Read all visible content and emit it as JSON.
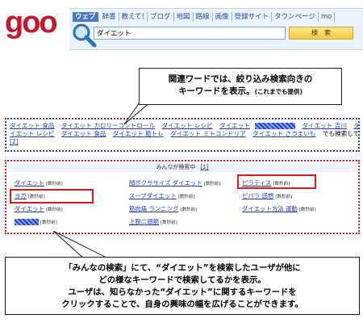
{
  "header": {
    "logo": "goo",
    "tabs": [
      "ウェブ",
      "辞書",
      "教えて!",
      "ブログ",
      "地図",
      "路線",
      "画像",
      "登録サイト",
      "タウンページ",
      "mo"
    ],
    "search_value": "ダイエット",
    "search_button": "検　索"
  },
  "callout_top": {
    "line1": "関連ワードでは、絞り込み検索向きの",
    "line2": "キーワードを表示。",
    "line2_small": "(これまでも提供)"
  },
  "related": {
    "row1": [
      "ダイエット 食品",
      "ダイエット カロリーコントロール",
      "ダイエット レシピ",
      "ダイエット",
      "ダイエット 吉川",
      "ダ"
    ],
    "row2": [
      "イエット レシピ",
      "ダイエット 食品",
      "ダイエット 筋トレ",
      "ダイエット ミトコンドリア",
      "ダイエット さつまいも"
    ],
    "row2_plain": "でも検索してみる",
    "row3": "[2]"
  },
  "minna": {
    "header": "みんなが検索中",
    "header_num": "[1]",
    "tag": "[数秒前]",
    "col1": [
      "ダイエット",
      "ヨガ",
      "ダイエット",
      ""
    ],
    "col2": [
      "顔ボクササイズ ダイエット",
      "スープダイエット",
      "筋肉痛 ランニング",
      "上腕二頭筋"
    ],
    "col3": [
      "ピラティス",
      "ピパラ 感想",
      "ダイエット方法 運動"
    ]
  },
  "callout_bottom": {
    "line1": "「みんなの検索」にて、“ダイエット”を検索したユーザが他に",
    "line2": "どの様なキーワードで検索してるかを表示。",
    "line3": "ユーザは、知らなかった“ダイエット”に関するキーワードを",
    "line4": "クリックすることで、自身の興味の幅を広げることができます。"
  },
  "colors": {
    "logo": "#c8162b",
    "link": "#1f3fd0",
    "highlight_red": "#e01818",
    "tab_active": "#4b78c9"
  }
}
